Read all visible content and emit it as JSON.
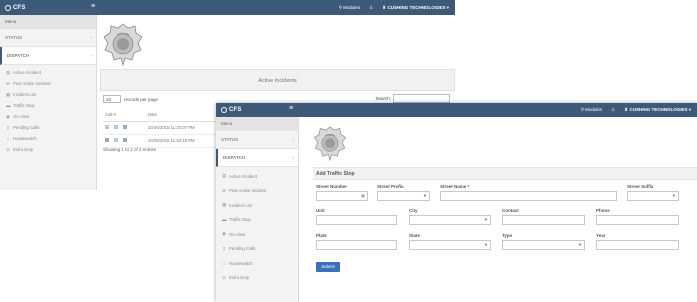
{
  "back": {
    "brand": "CFS",
    "hamburger": "≡",
    "topbar": {
      "items": [
        {
          "icon": "filter-icon",
          "label": "Modules"
        },
        {
          "icon": "user-icon",
          "label": ""
        },
        {
          "icon": "building-icon",
          "label": "CUSHING TECHNOLOGIES"
        }
      ]
    },
    "menu_header": "Menu",
    "groups": [
      "STATUS",
      "DISPATCH"
    ],
    "items": [
      {
        "icon": "clipboard-icon",
        "label": "Active Incident"
      },
      {
        "icon": "plus-circle-icon",
        "label": "Post Active Incident"
      },
      {
        "icon": "list-icon",
        "label": "Incident List"
      },
      {
        "icon": "car-icon",
        "label": "Traffic Stop"
      },
      {
        "icon": "eye-icon",
        "label": "On View"
      },
      {
        "icon": "file-icon",
        "label": "Pending Calls"
      },
      {
        "icon": "home-icon",
        "label": "Housewatch"
      },
      {
        "icon": "clock-icon",
        "label": "Extra Duty"
      }
    ],
    "panel_title": "Active Incidents",
    "entries": {
      "value": "10",
      "label": "records per page"
    },
    "search_label": "Search:",
    "table": {
      "headers": [
        "Call #",
        "Date"
      ],
      "rows": [
        {
          "date": "10/26/2015 11:20:07 PM"
        },
        {
          "date": "10/26/2015 11:20:18 PM"
        }
      ]
    },
    "showing": "Showing 1 to 2 of 2 entries"
  },
  "front": {
    "brand": "CFS",
    "hamburger": "≡",
    "topbar": {
      "items": [
        {
          "icon": "filter-icon",
          "label": "Modules"
        },
        {
          "icon": "user-icon",
          "label": ""
        },
        {
          "icon": "building-icon",
          "label": "CUSHING TECHNOLOGIES"
        }
      ]
    },
    "menu_header": "Menu",
    "groups": [
      "STATUS",
      "DISPATCH"
    ],
    "items": [
      {
        "icon": "clipboard-icon",
        "label": "Active Incident"
      },
      {
        "icon": "plus-circle-icon",
        "label": "Post Active Incident"
      },
      {
        "icon": "list-icon",
        "label": "Incident List"
      },
      {
        "icon": "car-icon",
        "label": "Traffic Stop"
      },
      {
        "icon": "eye-icon",
        "label": "On View"
      },
      {
        "icon": "file-icon",
        "label": "Pending Calls"
      },
      {
        "icon": "home-icon",
        "label": "Housewatch"
      },
      {
        "icon": "clock-icon",
        "label": "Extra Duty"
      }
    ],
    "form": {
      "title": "Add Traffic Stop",
      "fields": {
        "street_number": {
          "label": "Street Number",
          "value": ""
        },
        "street_prefix": {
          "label": "Street Prefix",
          "value": ""
        },
        "street_name": {
          "label": "Street Name *",
          "value": ""
        },
        "street_suffix": {
          "label": "Street Suffix",
          "value": ""
        },
        "unit": {
          "label": "Unit",
          "value": ""
        },
        "city": {
          "label": "City",
          "value": ""
        },
        "contact": {
          "label": "Contact",
          "value": ""
        },
        "phone": {
          "label": "Phone",
          "value": ""
        },
        "plate": {
          "label": "Plate",
          "value": ""
        },
        "state": {
          "label": "State",
          "value": ""
        },
        "type": {
          "label": "Type",
          "value": ""
        },
        "year": {
          "label": "Year",
          "value": ""
        }
      },
      "submit_label": "Submit"
    }
  },
  "colors": {
    "topbar": "#3d5a7a",
    "submit": "#3b6fb6",
    "sidebar": "#f3f3f3"
  }
}
